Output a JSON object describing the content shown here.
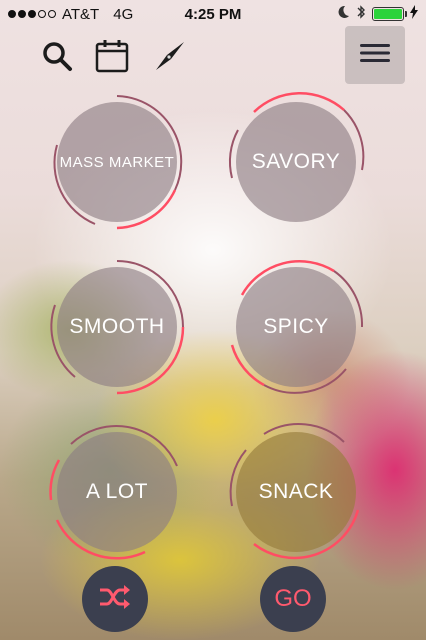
{
  "status_bar": {
    "carrier": "AT&T",
    "network": "4G",
    "time": "4:25 PM",
    "signal_bars_filled": 3,
    "signal_bars_total": 5,
    "battery_level": 1.0,
    "battery_color": "#2bd33b"
  },
  "toolbar": {
    "icons": [
      "search-icon",
      "calendar-icon",
      "compass-icon"
    ],
    "menu_icon": "hamburger-menu-icon"
  },
  "categories": [
    {
      "label": "MASS MARKET"
    },
    {
      "label": "SAVORY"
    },
    {
      "label": "SMOOTH"
    },
    {
      "label": "SPICY"
    },
    {
      "label": "A LOT"
    },
    {
      "label": "SNACK"
    }
  ],
  "bottom": {
    "shuffle_icon": "shuffle-icon",
    "go_label": "GO"
  },
  "colors": {
    "ring_accent": "#ff4d63",
    "ring_muted": "#9a5468",
    "button_bg": "#3b3f4f",
    "button_fg": "#ff5a6e"
  }
}
